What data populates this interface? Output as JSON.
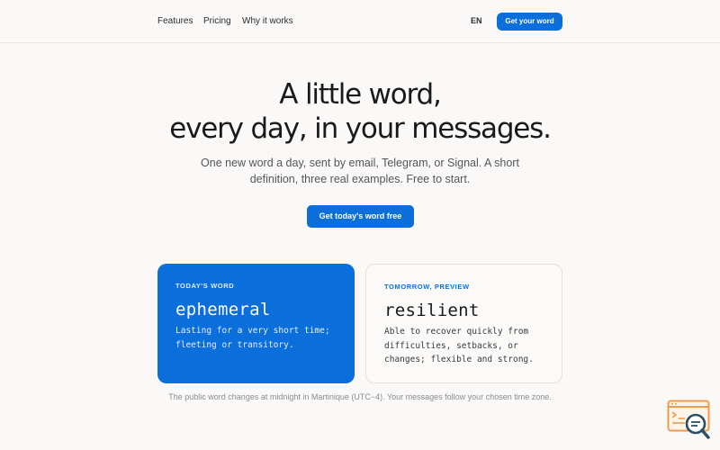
{
  "nav": {
    "features": "Features",
    "pricing": "Pricing",
    "why": "Why it works",
    "lang": "EN",
    "cta": "Get your word"
  },
  "hero": {
    "title_line1": "A little word,",
    "title_line2": "every day, in your messages.",
    "subtitle": "One new word a day, sent by email, Telegram, or Signal. A short definition, three real examples. Free to start.",
    "cta": "Get today's word free"
  },
  "cards": {
    "today": {
      "label": "TODAY'S WORD",
      "word": "ephemeral",
      "definition": "Lasting for a very short time; fleeting or transitory."
    },
    "tomorrow": {
      "label": "TOMORROW, PREVIEW",
      "word": "resilient",
      "definition": "Able to recover quickly from difficulties, setbacks, or changes; flexible and strong."
    }
  },
  "footnote": "The public word changes at midnight in Martinique (UTC−4). Your messages follow your chosen time zone.",
  "colors": {
    "accent": "#0a6edb",
    "background": "#faf9f7",
    "widget": "#f29a4a"
  },
  "icons": {
    "widget": "feedback-search-icon"
  }
}
